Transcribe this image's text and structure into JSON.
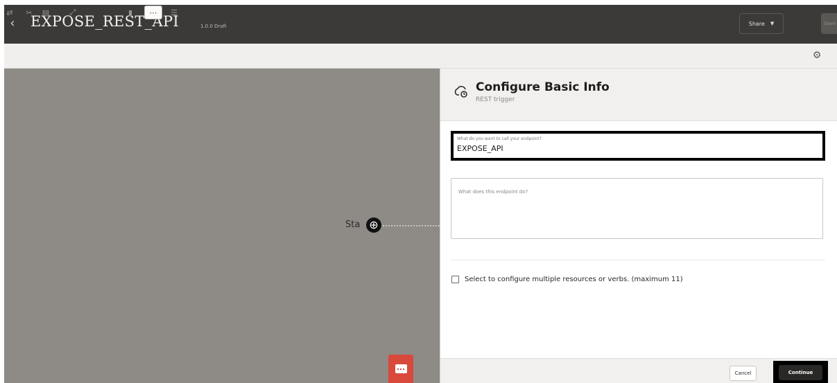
{
  "header": {
    "back_icon": "chevron-left-icon",
    "title": "EXPOSE_REST_API",
    "badge": "1.0.0 Draft",
    "share_label": "Share",
    "ghost_label": "Save"
  },
  "toolbar": {
    "icons": [
      "edit-mode-icon",
      "cut-icon",
      "paste-icon",
      "expand-icon",
      "vertical-layout-icon",
      "horizontal-layout-icon",
      "pseudo-view-icon"
    ],
    "settings_icon": "gear-icon"
  },
  "canvas": {
    "start_label": "Sta",
    "chat_icon": "chat-icon"
  },
  "panel": {
    "title": "Configure Basic Info",
    "subtitle": "REST trigger",
    "name_field_label": "What do you want to call your endpoint?",
    "name_field_value": "EXPOSE_API",
    "desc_placeholder": "What does this endpoint do?",
    "checkbox_label": "Select to configure multiple resources or verbs. (maximum 11)",
    "checkbox_checked": false,
    "cancel_label": "Cancel",
    "continue_label": "Continue"
  },
  "colors": {
    "header_bg": "#3c3a38",
    "canvas_bg": "#8e8a86",
    "chat_accent": "#d9493b"
  }
}
